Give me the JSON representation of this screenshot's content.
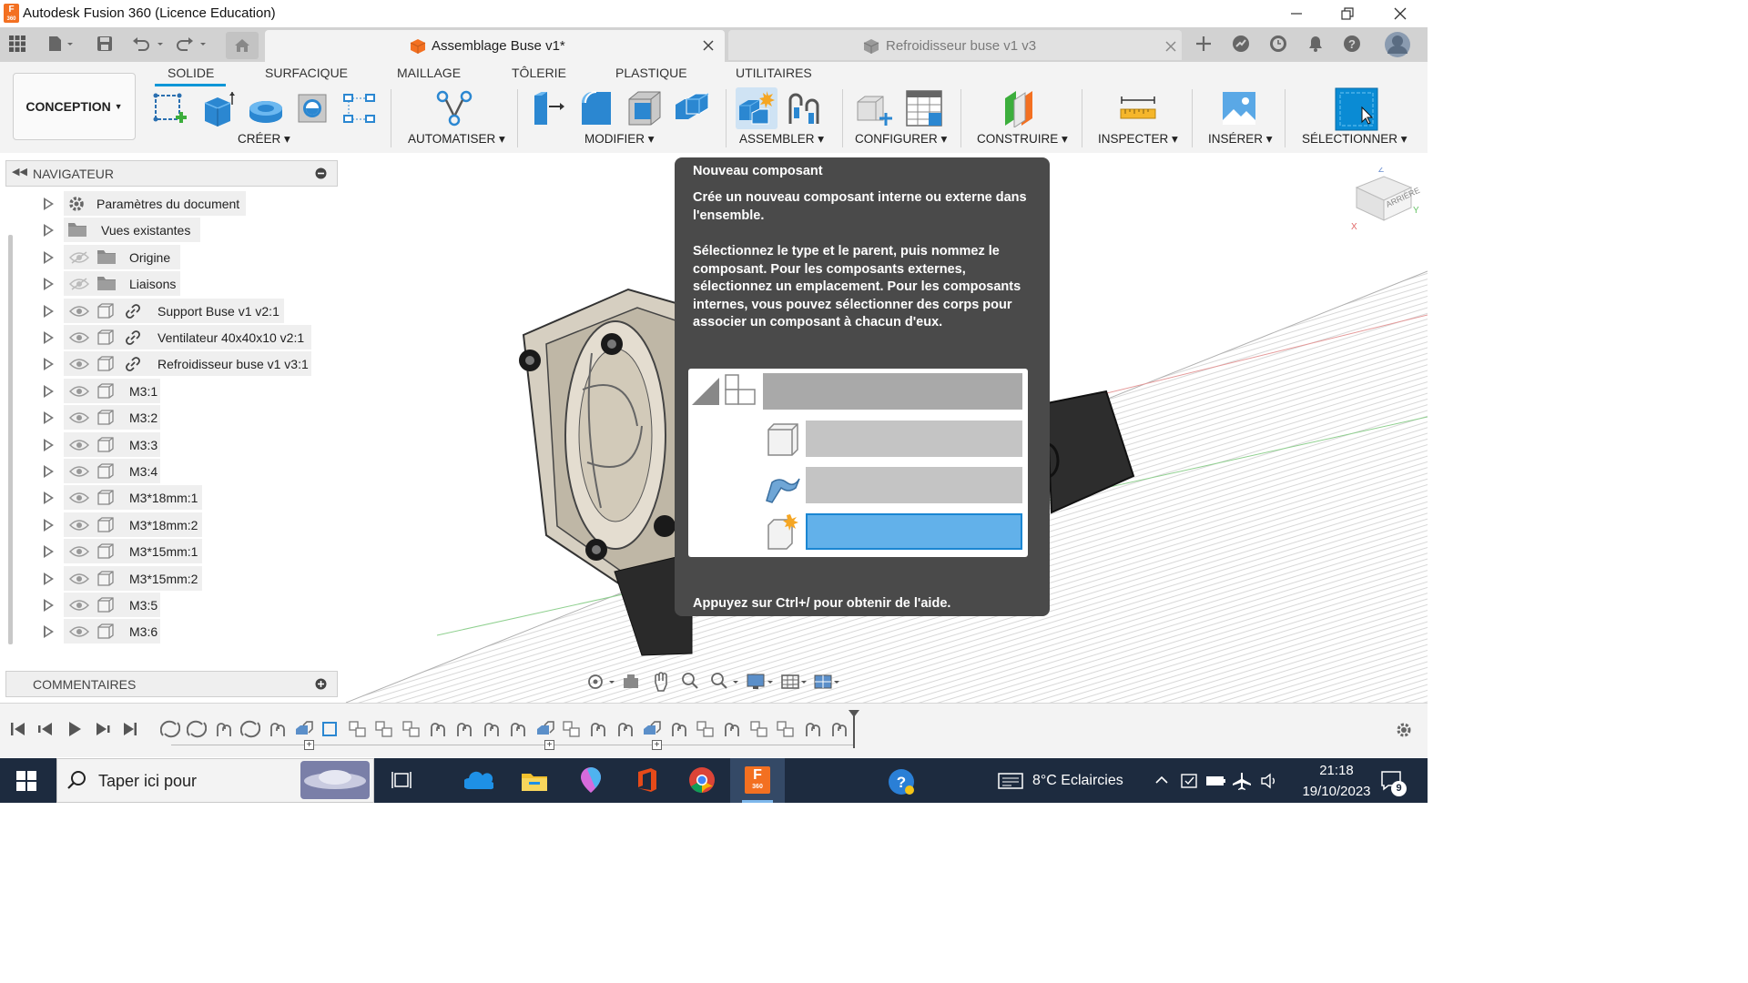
{
  "window": {
    "title": "Autodesk Fusion 360 (Licence Education)",
    "app_icon_letter": "F",
    "app_icon_sub": "360"
  },
  "tabs": [
    {
      "label": "Assemblage Buse v1*",
      "active": true
    },
    {
      "label": "Refroidisseur buse v1 v3",
      "active": false
    }
  ],
  "toolbar": {
    "workspace": "CONCEPTION",
    "tabs": [
      "SOLIDE",
      "SURFACIQUE",
      "MAILLAGE",
      "TÔLERIE",
      "PLASTIQUE",
      "UTILITAIRES"
    ],
    "active_tab": "SOLIDE",
    "groups": [
      "CRÉER",
      "AUTOMATISER",
      "MODIFIER",
      "ASSEMBLER",
      "CONFIGURER",
      "CONSTRUIRE",
      "INSPECTER",
      "INSÉRER",
      "SÉLECTIONNER"
    ]
  },
  "browser": {
    "title": "NAVIGATEUR",
    "items": [
      {
        "label": "Paramètres du document",
        "icon": "gear-icon"
      },
      {
        "label": "Vues existantes",
        "icon": "folder-icon"
      },
      {
        "label": "Origine",
        "icon": "folder-icon",
        "hidden": true
      },
      {
        "label": "Liaisons",
        "icon": "folder-icon",
        "hidden": true
      },
      {
        "label": "Support Buse v1 v2:1",
        "icon": "component-icon",
        "linked": true
      },
      {
        "label": "Ventilateur 40x40x10 v2:1",
        "icon": "component-icon",
        "linked": true
      },
      {
        "label": "Refroidisseur buse v1 v3:1",
        "icon": "component-icon",
        "linked": true
      },
      {
        "label": "M3:1",
        "icon": "component-icon"
      },
      {
        "label": "M3:2",
        "icon": "component-icon"
      },
      {
        "label": "M3:3",
        "icon": "component-icon"
      },
      {
        "label": "M3:4",
        "icon": "component-icon"
      },
      {
        "label": "M3*18mm:1",
        "icon": "component-icon"
      },
      {
        "label": "M3*18mm:2",
        "icon": "component-icon"
      },
      {
        "label": "M3*15mm:1",
        "icon": "component-icon"
      },
      {
        "label": "M3*15mm:2",
        "icon": "component-icon"
      },
      {
        "label": "M3:5",
        "icon": "component-icon"
      },
      {
        "label": "M3:6",
        "icon": "component-icon"
      }
    ],
    "comments": "COMMENTAIRES"
  },
  "tooltip": {
    "title": "Nouveau composant",
    "p1": "Crée un nouveau composant interne ou externe dans l'ensemble.",
    "p2": "Sélectionnez le type et le parent, puis nommez le composant. Pour les composants externes, sélectionnez un emplacement. Pour les composants internes, vous pouvez sélectionner des corps pour associer un composant à chacun d'eux.",
    "footer": "Appuyez sur Ctrl+/ pour obtenir de l'aide."
  },
  "viewcube": {
    "face": "ARRIÈRE",
    "axis_z": "Z",
    "axis_x": "X",
    "axis_y": "Y"
  },
  "taskbar": {
    "search_placeholder": "Taper ici pour",
    "weather": "8°C  Eclaircies",
    "time": "21:18",
    "date": "19/10/2023",
    "notifications": "9"
  },
  "colors": {
    "accent": "#0696d7",
    "tooltip_bg": "#4a4a4a",
    "taskbar": "#1d2b3f",
    "fusion_orange": "#f37021"
  }
}
